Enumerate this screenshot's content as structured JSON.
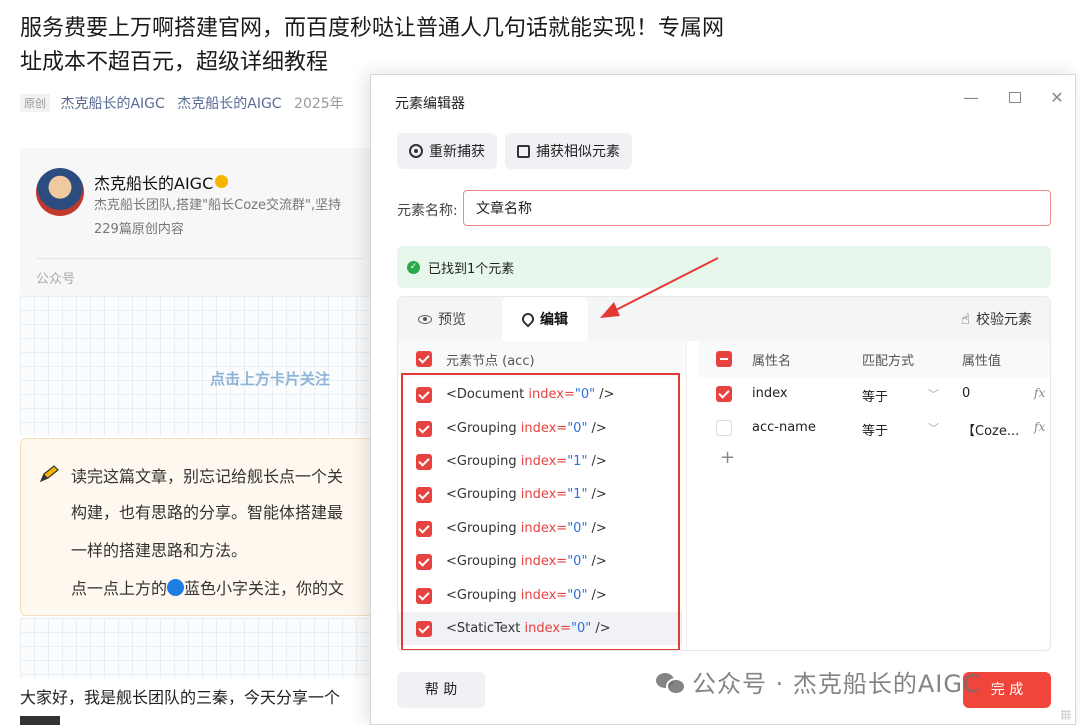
{
  "article": {
    "title": "服务费要上万啊搭建官网，而百度秒哒让普通人几句话就能实现！专属网址成本不超百元，超级详细教程",
    "meta": {
      "tag": "原创",
      "author1": "杰克船长的AIGC",
      "author2": "杰克船长的AIGC",
      "date": "2025年"
    },
    "profile": {
      "name": "杰克船长的AIGC",
      "desc": "杰克船长团队,搭建\"船长Coze交流群\",坚持",
      "count": "229篇原创内容",
      "label": "公众号"
    },
    "follow_tip": "点击上方卡片关注",
    "note": {
      "line1": "读完这篇文章，别忘记给舰长点一个关",
      "line2": "构建，也有思路的分享。智能体搭建最",
      "line3": "一样的搭建思路和方法。",
      "line4a": "点一点上方的",
      "line4b": "蓝色小字关注，你的文"
    },
    "bottom_text": "大家好，我是舰长团队的三秦，今天分享一个"
  },
  "dialog": {
    "title": "元素编辑器",
    "controls": {
      "minimize": "—",
      "maximize": "",
      "close": "✕"
    },
    "toolbar": {
      "recapture": "重新捕获",
      "capture_similar": "捕获相似元素"
    },
    "name_label": "元素名称:",
    "name_value": "文章名称",
    "found_text": "已找到1个元素",
    "tabs": {
      "preview": "预览",
      "edit": "编辑",
      "verify": "校验元素"
    },
    "tree_header": "元素节点 (acc)",
    "tree": [
      {
        "tag": "<Document",
        "attr": "index=",
        "val": "\"0\"",
        "end": " />"
      },
      {
        "tag": "<Grouping",
        "attr": "index=",
        "val": "\"0\"",
        "end": " />"
      },
      {
        "tag": "<Grouping",
        "attr": "index=",
        "val": "\"1\"",
        "end": " />"
      },
      {
        "tag": "<Grouping",
        "attr": "index=",
        "val": "\"1\"",
        "end": " />"
      },
      {
        "tag": "<Grouping",
        "attr": "index=",
        "val": "\"0\"",
        "end": " />"
      },
      {
        "tag": "<Grouping",
        "attr": "index=",
        "val": "\"0\"",
        "end": " />"
      },
      {
        "tag": "<Grouping",
        "attr": "index=",
        "val": "\"0\"",
        "end": " />"
      },
      {
        "tag": "<StaticText",
        "attr": "index=",
        "val": "\"0\"",
        "end": " />"
      }
    ],
    "props_header": {
      "name": "属性名",
      "match": "匹配方式",
      "value": "属性值"
    },
    "props": [
      {
        "checked": true,
        "name": "index",
        "match": "等于",
        "value": "0",
        "fx": "fx"
      },
      {
        "checked": false,
        "name": "acc-name",
        "match": "等于",
        "value": "【Coze...",
        "fx": "fx"
      }
    ],
    "add_prop": "+",
    "help": "帮 助",
    "done": "完 成"
  },
  "watermark": "公众号 · 杰克船长的AIGC",
  "colors": {
    "accent": "#e64340",
    "success": "#2aa84a",
    "link": "#576b95",
    "annotation": "#e53935"
  }
}
